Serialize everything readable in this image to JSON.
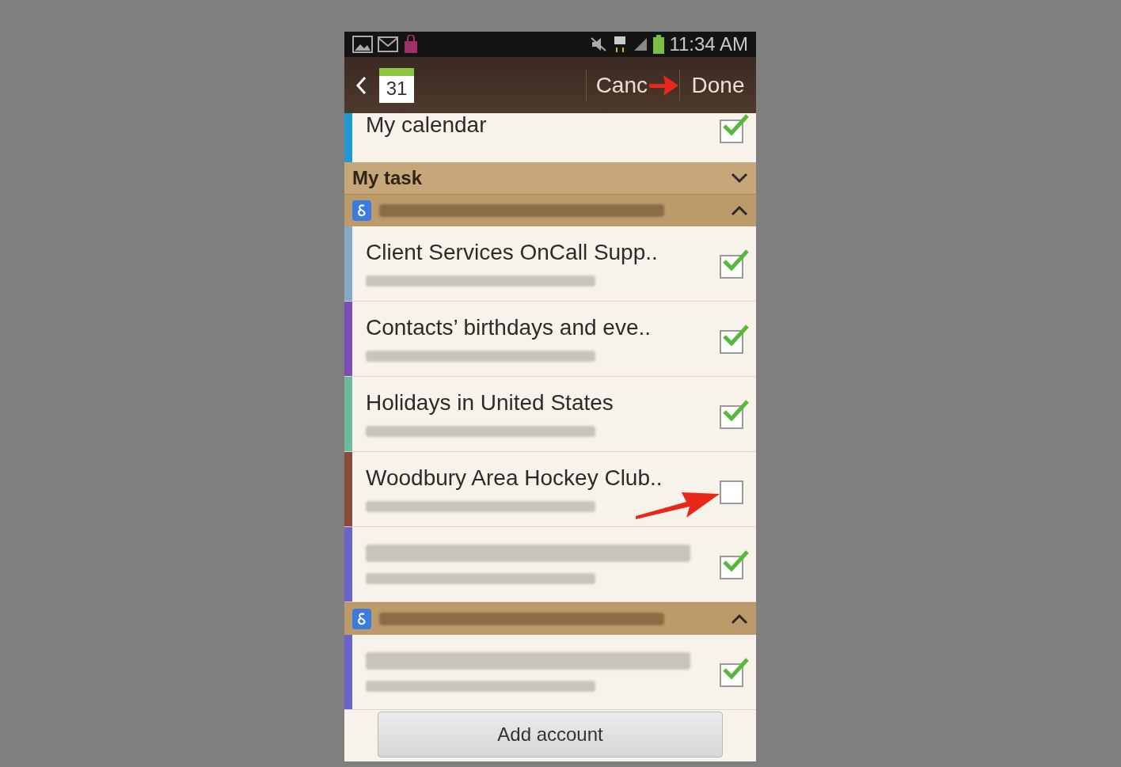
{
  "status_bar": {
    "time": "11:34 AM"
  },
  "action_bar": {
    "date_icon": "31",
    "cancel": "Canc",
    "done": "Done"
  },
  "my_calendar": {
    "name": "My calendar",
    "color": "#1e9ad6",
    "checked": true
  },
  "my_task": {
    "label": "My task",
    "expanded": false
  },
  "accounts": [
    {
      "expanded": true,
      "calendars": [
        {
          "kind": "named",
          "name": "Client Services OnCall Supp..",
          "color": "#86a9c9",
          "checked": true
        },
        {
          "kind": "named",
          "name": "Contacts’ birthdays and eve..",
          "color": "#7a4fb8",
          "checked": true
        },
        {
          "kind": "named",
          "name": "Holidays in United States",
          "color": "#6dbb9c",
          "checked": true
        },
        {
          "kind": "named",
          "name": "Woodbury Area Hockey Club..",
          "color": "#8b4b3b",
          "checked": false
        },
        {
          "kind": "blurred",
          "color": "#6a63cc",
          "checked": true
        }
      ]
    },
    {
      "expanded": true,
      "calendars": [
        {
          "kind": "blurred",
          "color": "#6a63cc",
          "checked": true
        }
      ]
    }
  ],
  "add_account": "Add account"
}
